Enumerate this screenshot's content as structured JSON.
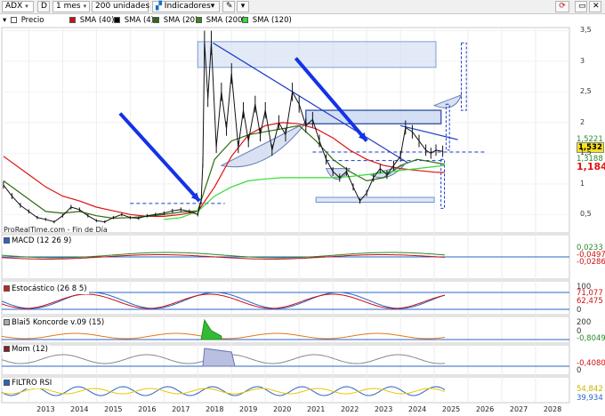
{
  "toolbar": {
    "ticker": "ADX",
    "period_type": "D",
    "timeframe": "1 mes",
    "units": "200 unidades",
    "indicators_label": "Indicadores"
  },
  "legend": {
    "price_label": "Precio",
    "sma": [
      {
        "label": "SMA (40)",
        "color": "#d01010"
      },
      {
        "label": "SMA (4)",
        "color": "#000000"
      },
      {
        "label": "SMA (20)",
        "color": "#2f6b10"
      },
      {
        "label": "SMA (200)",
        "color": "#3c8a18"
      },
      {
        "label": "SMA (120)",
        "color": "#33dd33"
      }
    ]
  },
  "credit": "ProRealTime.com - Fin de Día",
  "price_values": {
    "last_price": "1,532",
    "upper_tag": "1,5221",
    "sma20_tag": "1,3188",
    "sma40_tag": "1,1845"
  },
  "panels": {
    "macd": {
      "label": "MACD (12 26 9)",
      "values": [
        "0,0233",
        "-0,0497",
        "-0,0286"
      ]
    },
    "stoch": {
      "label": "Estocástico (26 8 5)",
      "values": [
        "71,077",
        "62,475"
      ],
      "ticks": [
        "100",
        "0"
      ]
    },
    "blai5": {
      "label": "Blai5 Koncorde v.09 (15)",
      "values": [
        "200",
        "0",
        "-0,8049"
      ]
    },
    "mom": {
      "label": "Mom (12)",
      "values": [
        "-0,4080",
        "0"
      ]
    },
    "rsi": {
      "label": "FILTRO RSI",
      "values": [
        "54,842",
        "39,934"
      ]
    }
  },
  "chart_data": {
    "type": "line",
    "title": "",
    "y_ticks": [
      "3,5",
      "3",
      "2,5",
      "2",
      "1,5",
      "1",
      "0,5"
    ],
    "ylim": [
      0.2,
      3.55
    ],
    "x_years": [
      "2013",
      "2014",
      "2015",
      "2016",
      "2017",
      "2018",
      "2019",
      "2020",
      "2021",
      "2022",
      "2023",
      "2024",
      "2025",
      "2026",
      "2027",
      "2028"
    ],
    "xlim": [
      2012.2,
      2029.0
    ],
    "price_series": [
      [
        2012.25,
        0.98
      ],
      [
        2012.5,
        0.8
      ],
      [
        2012.75,
        0.65
      ],
      [
        2013.0,
        0.55
      ],
      [
        2013.25,
        0.45
      ],
      [
        2013.5,
        0.42
      ],
      [
        2013.75,
        0.38
      ],
      [
        2014.0,
        0.48
      ],
      [
        2014.25,
        0.62
      ],
      [
        2014.5,
        0.58
      ],
      [
        2014.75,
        0.48
      ],
      [
        2015.0,
        0.4
      ],
      [
        2015.25,
        0.38
      ],
      [
        2015.5,
        0.45
      ],
      [
        2015.75,
        0.5
      ],
      [
        2016.0,
        0.45
      ],
      [
        2016.25,
        0.44
      ],
      [
        2016.5,
        0.48
      ],
      [
        2016.75,
        0.5
      ],
      [
        2017.0,
        0.52
      ],
      [
        2017.25,
        0.56
      ],
      [
        2017.5,
        0.58
      ],
      [
        2017.75,
        0.55
      ],
      [
        2018.0,
        0.5
      ],
      [
        2018.1,
        0.72
      ],
      [
        2018.15,
        1.35
      ],
      [
        2018.2,
        3.3
      ],
      [
        2018.3,
        2.4
      ],
      [
        2018.4,
        3.3
      ],
      [
        2018.55,
        1.6
      ],
      [
        2018.7,
        2.5
      ],
      [
        2018.85,
        1.9
      ],
      [
        2019.0,
        2.8
      ],
      [
        2019.2,
        1.6
      ],
      [
        2019.35,
        2.2
      ],
      [
        2019.5,
        1.7
      ],
      [
        2019.7,
        2.3
      ],
      [
        2019.85,
        1.8
      ],
      [
        2020.0,
        2.2
      ],
      [
        2020.2,
        1.55
      ],
      [
        2020.4,
        2.0
      ],
      [
        2020.6,
        1.8
      ],
      [
        2020.8,
        2.5
      ],
      [
        2021.0,
        2.3
      ],
      [
        2021.2,
        1.95
      ],
      [
        2021.4,
        2.05
      ],
      [
        2021.6,
        1.7
      ],
      [
        2021.8,
        1.4
      ],
      [
        2022.0,
        1.2
      ],
      [
        2022.2,
        1.1
      ],
      [
        2022.4,
        1.2
      ],
      [
        2022.6,
        0.95
      ],
      [
        2022.8,
        0.72
      ],
      [
        2023.0,
        0.85
      ],
      [
        2023.2,
        1.1
      ],
      [
        2023.4,
        1.25
      ],
      [
        2023.6,
        1.15
      ],
      [
        2023.8,
        1.3
      ],
      [
        2024.0,
        1.45
      ],
      [
        2024.15,
        1.92
      ],
      [
        2024.35,
        1.85
      ],
      [
        2024.55,
        1.7
      ],
      [
        2024.75,
        1.55
      ],
      [
        2024.9,
        1.5
      ],
      [
        2025.05,
        1.55
      ],
      [
        2025.25,
        1.532
      ]
    ],
    "series": [
      {
        "name": "SMA (40)",
        "color": "#e01010",
        "points": [
          [
            2012.25,
            1.45
          ],
          [
            2013.0,
            1.15
          ],
          [
            2013.5,
            0.95
          ],
          [
            2014.0,
            0.8
          ],
          [
            2014.5,
            0.72
          ],
          [
            2015.0,
            0.62
          ],
          [
            2015.5,
            0.56
          ],
          [
            2016.0,
            0.5
          ],
          [
            2016.5,
            0.47
          ],
          [
            2017.0,
            0.47
          ],
          [
            2017.5,
            0.5
          ],
          [
            2018.0,
            0.55
          ],
          [
            2018.5,
            0.95
          ],
          [
            2019.0,
            1.45
          ],
          [
            2019.5,
            1.8
          ],
          [
            2020.0,
            1.95
          ],
          [
            2020.5,
            2.0
          ],
          [
            2021.0,
            1.98
          ],
          [
            2021.5,
            1.9
          ],
          [
            2022.0,
            1.75
          ],
          [
            2022.5,
            1.55
          ],
          [
            2023.0,
            1.4
          ],
          [
            2023.5,
            1.3
          ],
          [
            2024.0,
            1.25
          ],
          [
            2024.5,
            1.22
          ],
          [
            2025.0,
            1.19
          ],
          [
            2025.3,
            1.1845
          ]
        ]
      },
      {
        "name": "SMA (20)",
        "color": "#2f6b10",
        "points": [
          [
            2012.25,
            1.05
          ],
          [
            2013.0,
            0.75
          ],
          [
            2013.5,
            0.55
          ],
          [
            2014.0,
            0.52
          ],
          [
            2014.5,
            0.55
          ],
          [
            2015.0,
            0.48
          ],
          [
            2015.5,
            0.44
          ],
          [
            2016.0,
            0.45
          ],
          [
            2016.5,
            0.47
          ],
          [
            2017.0,
            0.5
          ],
          [
            2017.5,
            0.54
          ],
          [
            2018.0,
            0.56
          ],
          [
            2018.5,
            1.4
          ],
          [
            2019.0,
            1.7
          ],
          [
            2019.5,
            1.8
          ],
          [
            2020.0,
            1.85
          ],
          [
            2020.5,
            1.9
          ],
          [
            2021.0,
            1.95
          ],
          [
            2021.5,
            1.7
          ],
          [
            2022.0,
            1.4
          ],
          [
            2022.5,
            1.2
          ],
          [
            2023.0,
            1.05
          ],
          [
            2023.5,
            1.1
          ],
          [
            2024.0,
            1.3
          ],
          [
            2024.5,
            1.4
          ],
          [
            2025.0,
            1.35
          ],
          [
            2025.3,
            1.3188
          ]
        ]
      },
      {
        "name": "SMA (120)",
        "color": "#33dd33",
        "points": [
          [
            2017.0,
            0.42
          ],
          [
            2017.5,
            0.45
          ],
          [
            2018.0,
            0.55
          ],
          [
            2018.5,
            0.8
          ],
          [
            2019.0,
            0.95
          ],
          [
            2019.5,
            1.05
          ],
          [
            2020.0,
            1.08
          ],
          [
            2020.5,
            1.1
          ],
          [
            2021.0,
            1.1
          ],
          [
            2021.5,
            1.1
          ],
          [
            2022.0,
            1.1
          ],
          [
            2022.5,
            1.12
          ],
          [
            2023.0,
            1.15
          ],
          [
            2023.5,
            1.18
          ],
          [
            2024.0,
            1.22
          ],
          [
            2024.5,
            1.25
          ],
          [
            2025.0,
            1.28
          ],
          [
            2025.3,
            1.3
          ]
        ]
      }
    ]
  }
}
